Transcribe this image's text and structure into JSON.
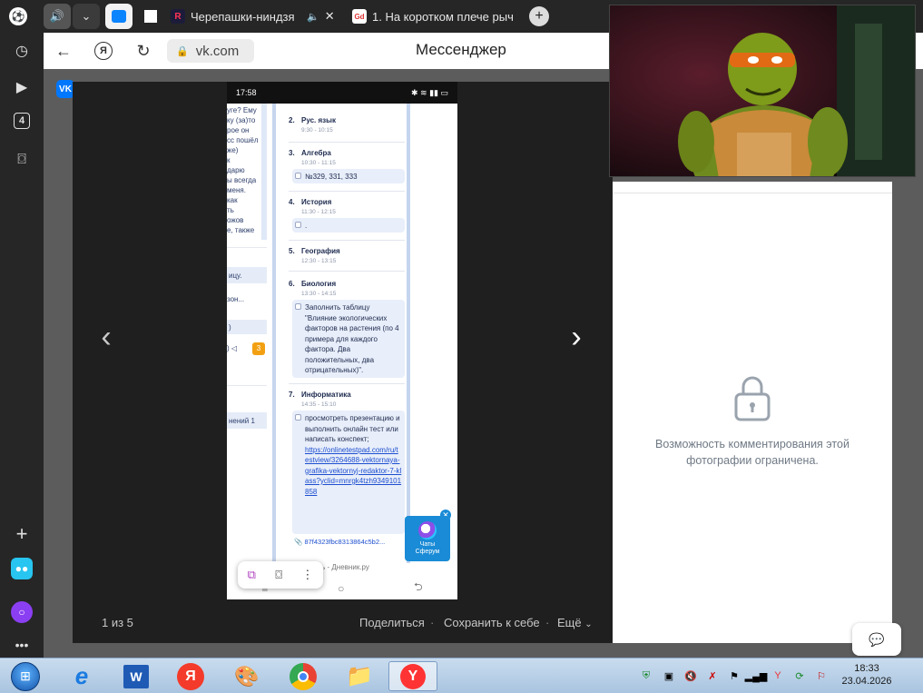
{
  "browser": {
    "tabs": [
      {
        "title": "Черепашки-ниндзя",
        "favicon": "R"
      },
      {
        "title": "1. На коротком плече рыч",
        "favicon": "Gd"
      }
    ],
    "url": "vk.com",
    "page_title": "Мессенджер",
    "sidebar_badge": "4"
  },
  "phone": {
    "status_time": "17:58",
    "left_snippets": [
      "уге? Ему",
      "ку (за)то",
      "рое он",
      "сс пошёл",
      "же)",
      "к",
      "дарю",
      "ы всегда",
      "меня.",
      "как",
      "ть",
      "ожов",
      "е, также",
      "ицу.",
      "зон...",
      ")",
      ") ◁",
      "нений 1"
    ],
    "left_badge": "3",
    "lessons": [
      {
        "num": "2.",
        "title": "Рус. язык",
        "time": "9:30 - 10:15"
      },
      {
        "num": "3.",
        "title": "Алгебра",
        "time": "10:30 - 11:15",
        "task": "№329, 331, 333"
      },
      {
        "num": "4.",
        "title": "История",
        "time": "11:30 - 12:15",
        "task": "."
      },
      {
        "num": "5.",
        "title": "География",
        "time": "12:30 - 13:15"
      },
      {
        "num": "6.",
        "title": "Биология",
        "time": "13:30 - 14:15",
        "task": "Заполнить таблицу \"Влияние экологических факторов на растения (по 4 примера для каждого фактора. Два положительных, два отрицательных)\"."
      },
      {
        "num": "7.",
        "title": "Информатика",
        "time": "14:35 - 15:10",
        "task": "просмотреть презентацию и выполнить онлайн тест или написать конспект;",
        "link": "https://onlinetestpad.com/ru/testview/3264688-vektornaya-grafika-vektornyj-redaktor-7-klass?yclid=mnrgk4tzh9349101858",
        "attachment": "87f4323fbc8313864c5b2..."
      }
    ],
    "footer_text": "ость - Дневник.ру",
    "sferum_label": "Чаты Сферум"
  },
  "viewer": {
    "counter": "1 из 5",
    "share": "Поделиться",
    "save": "Сохранить к себе",
    "more": "Ещё"
  },
  "comments": {
    "restricted_msg": "Возможность комментирования этой фотографии ограничена."
  },
  "taskbar": {
    "time": "18:33",
    "date": "23.04.2026"
  },
  "colors": {
    "vk_blue": "#0077ff",
    "sferum_blue": "#1a8bd6",
    "link_blue": "#1d4fcf"
  }
}
